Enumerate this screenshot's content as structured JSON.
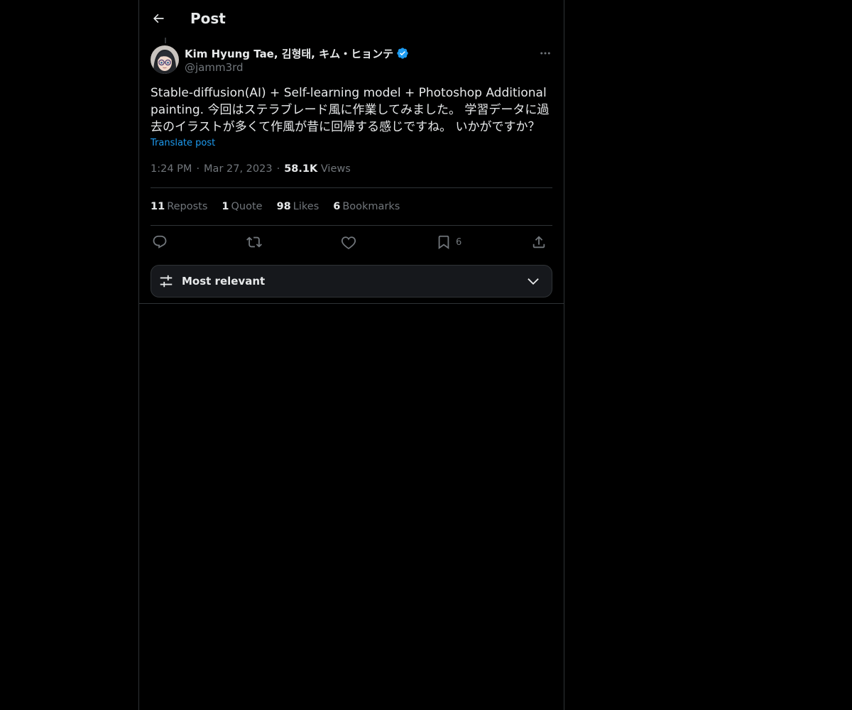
{
  "header": {
    "title": "Post",
    "back_icon": "arrow-left-icon"
  },
  "post": {
    "author": {
      "name": "Kim Hyung Tae, 김형태, キム・ヒョンテ",
      "handle": "@jamm3rd",
      "verified": true,
      "verified_color": "#1d9bf0"
    },
    "text": "Stable-diffusion(AI) + Self-learning model + Photoshop Additional painting. 今回はステラブレード風に作業してみました。 学習データに過去のイラストが多くて作風が昔に回帰する感じですね。 いかがですか？",
    "translate_label": "Translate post",
    "time": "1:24 PM",
    "date": "Mar 27, 2023",
    "separator": "·",
    "views_count": "58.1K",
    "views_label": "Views"
  },
  "stats": [
    {
      "count": "11",
      "label": "Reposts"
    },
    {
      "count": "1",
      "label": "Quote"
    },
    {
      "count": "98",
      "label": "Likes"
    },
    {
      "count": "6",
      "label": "Bookmarks"
    }
  ],
  "actions": {
    "reply_icon": "reply-icon",
    "repost_icon": "repost-icon",
    "like_icon": "heart-icon",
    "bookmark_icon": "bookmark-icon",
    "bookmark_count": "6",
    "share_icon": "share-icon"
  },
  "sort": {
    "label": "Most relevant",
    "icon": "sliders-icon",
    "chevron": "chevron-down-icon"
  },
  "colors": {
    "background": "#000000",
    "text_primary": "#e7e9ea",
    "text_secondary": "#71767b",
    "accent": "#1d9bf0",
    "border": "#2f3336"
  }
}
